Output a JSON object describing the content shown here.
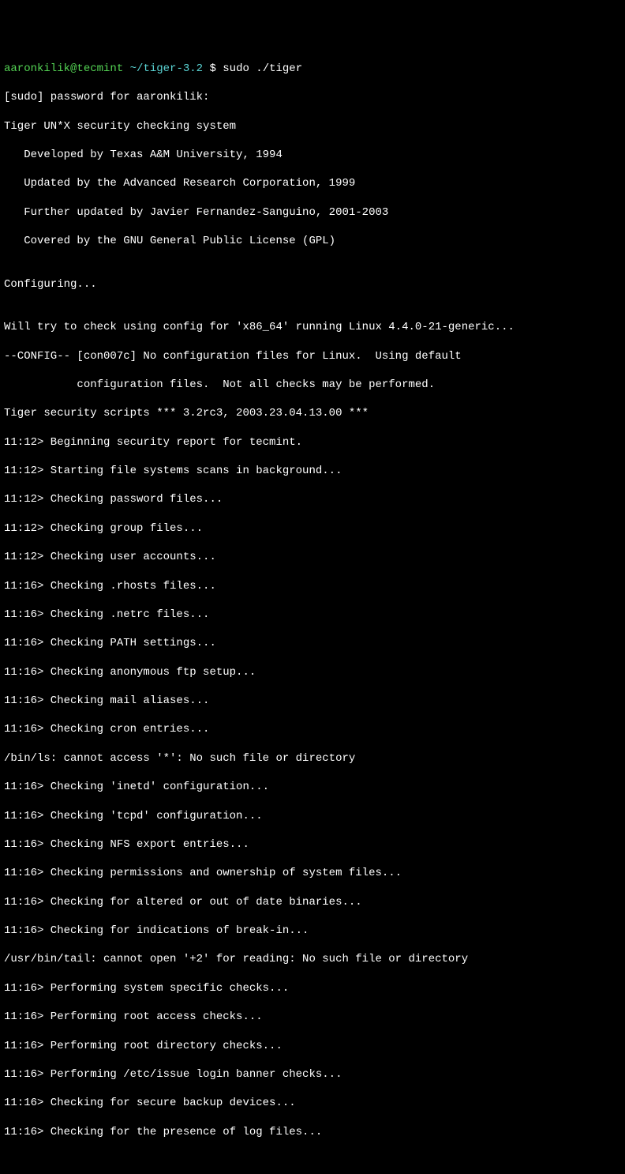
{
  "prompt": {
    "user": "aaronkilik@tecmint",
    "pathSep": " ",
    "path": "~/tiger-3.2",
    "dollar": " $ ",
    "command": "sudo ./tiger"
  },
  "lines": [
    "[sudo] password for aaronkilik:",
    "Tiger UN*X security checking system",
    "   Developed by Texas A&M University, 1994",
    "   Updated by the Advanced Research Corporation, 1999",
    "   Further updated by Javier Fernandez-Sanguino, 2001-2003",
    "   Covered by the GNU General Public License (GPL)",
    "",
    "Configuring...",
    "",
    "Will try to check using config for 'x86_64' running Linux 4.4.0-21-generic...",
    "--CONFIG-- [con007c] No configuration files for Linux.  Using default",
    "           configuration files.  Not all checks may be performed.",
    "Tiger security scripts *** 3.2rc3, 2003.23.04.13.00 ***",
    "11:12> Beginning security report for tecmint.",
    "11:12> Starting file systems scans in background...",
    "11:12> Checking password files...",
    "11:12> Checking group files...",
    "11:12> Checking user accounts...",
    "11:16> Checking .rhosts files...",
    "11:16> Checking .netrc files...",
    "11:16> Checking PATH settings...",
    "11:16> Checking anonymous ftp setup...",
    "11:16> Checking mail aliases...",
    "11:16> Checking cron entries...",
    "/bin/ls: cannot access '*': No such file or directory",
    "11:16> Checking 'inetd' configuration...",
    "11:16> Checking 'tcpd' configuration...",
    "11:16> Checking NFS export entries...",
    "11:16> Checking permissions and ownership of system files...",
    "11:16> Checking for altered or out of date binaries...",
    "11:16> Checking for indications of break-in...",
    "/usr/bin/tail: cannot open '+2' for reading: No such file or directory",
    "11:16> Performing system specific checks...",
    "11:16> Performing root access checks...",
    "11:16> Performing root directory checks...",
    "11:16> Performing /etc/issue login banner checks...",
    "11:16> Checking for secure backup devices...",
    "11:16> Checking for the presence of log files..."
  ]
}
